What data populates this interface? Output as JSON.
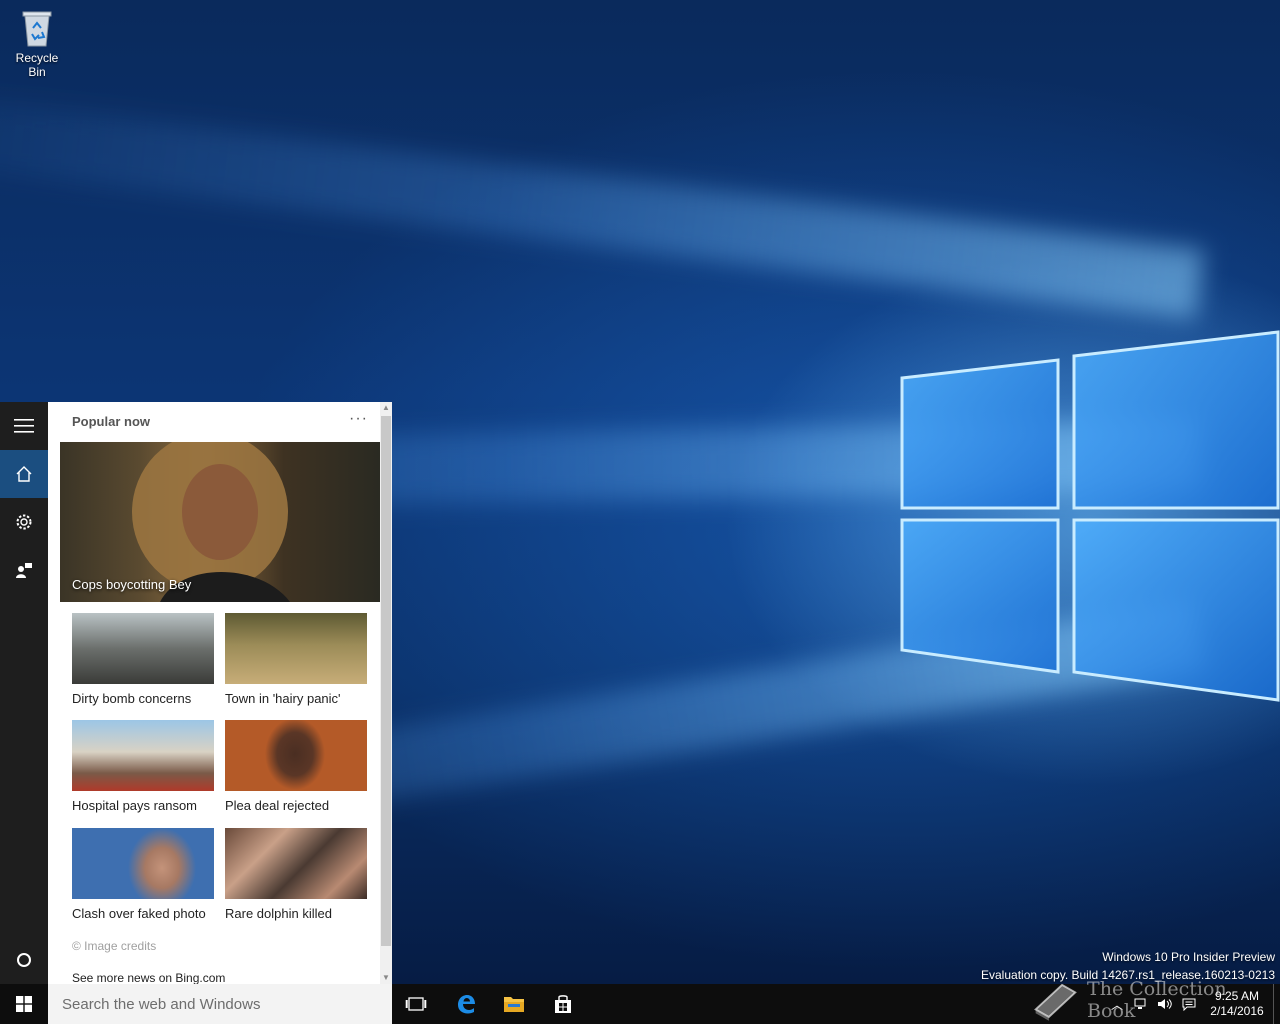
{
  "desktop": {
    "icons": [
      {
        "label": "Recycle Bin",
        "icon": "recycle-bin-icon"
      }
    ],
    "watermark": {
      "line1": "Windows 10 Pro Insider Preview",
      "line2": "Evaluation copy. Build 14267.rs1_release.160213-0213"
    },
    "overlay_logo_text": "The Collection Book"
  },
  "cortana": {
    "rail": [
      "hamburger-menu-icon",
      "home-icon",
      "settings-icon",
      "feedback-icon",
      "cortana-circle-icon"
    ],
    "section_title": "Popular now",
    "more_label": "···",
    "hero": {
      "caption": "Cops boycotting Bey"
    },
    "tiles": [
      {
        "caption": "Dirty bomb concerns"
      },
      {
        "caption": "Town in 'hairy panic'"
      },
      {
        "caption": "Hospital pays ransom"
      },
      {
        "caption": "Plea deal rejected"
      },
      {
        "caption": "Clash over faked photo"
      },
      {
        "caption": "Rare dolphin killed"
      }
    ],
    "image_credits": "© Image credits",
    "see_more": "See more news on Bing.com"
  },
  "taskbar": {
    "search_placeholder": "Search the web and Windows",
    "pinned": [
      "task-view-icon",
      "edge-icon",
      "file-explorer-icon",
      "store-icon"
    ],
    "clock": {
      "time": "9:25 AM",
      "date": "2/14/2016"
    }
  },
  "colors": {
    "accent": "#1b4e80",
    "rail": "#1e1e1e",
    "taskbar": "#0d0d0d"
  }
}
